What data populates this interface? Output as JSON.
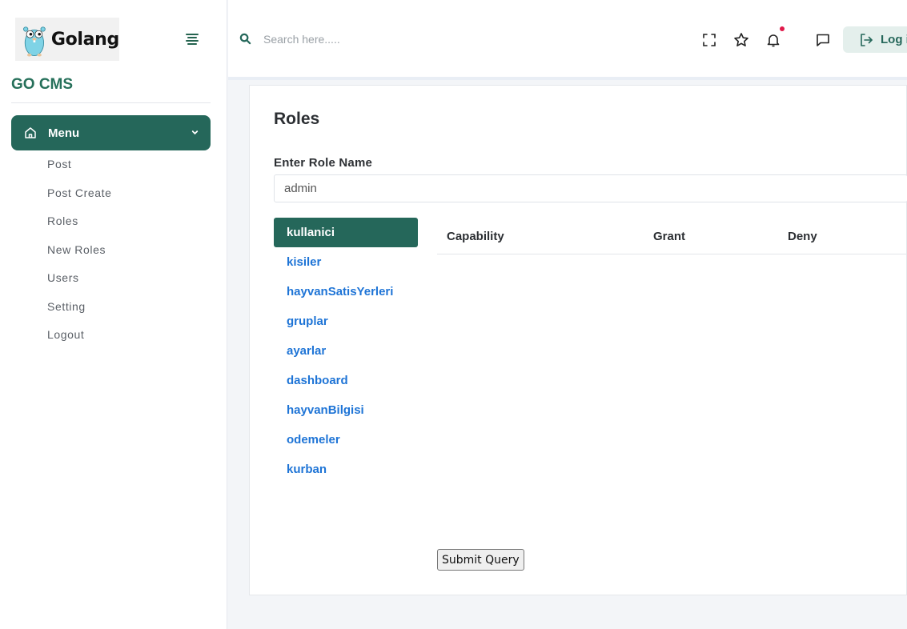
{
  "sidebar": {
    "logo_text": "Golang",
    "brand": "GO CMS",
    "menu_label": "Menu",
    "items": [
      {
        "label": "Post"
      },
      {
        "label": "Post Create"
      },
      {
        "label": "Roles"
      },
      {
        "label": "New Roles"
      },
      {
        "label": "Users"
      },
      {
        "label": "Setting"
      },
      {
        "label": "Logout"
      }
    ]
  },
  "header": {
    "search_placeholder": "Search here.....",
    "login_label": "Log in",
    "icons": [
      "fullscreen-icon",
      "star-icon",
      "bell-icon",
      "chat-icon"
    ]
  },
  "main": {
    "title": "Roles",
    "role_name_label": "Enter Role Name",
    "role_name_value": "admin",
    "tabs": [
      {
        "label": "kullanici",
        "active": true
      },
      {
        "label": "kisiler"
      },
      {
        "label": "hayvanSatisYerleri"
      },
      {
        "label": "gruplar"
      },
      {
        "label": "ayarlar"
      },
      {
        "label": "dashboard"
      },
      {
        "label": "hayvanBilgisi"
      },
      {
        "label": "odemeler"
      },
      {
        "label": "kurban"
      }
    ],
    "table_headers": {
      "capability": "Capability",
      "grant": "Grant",
      "deny": "Deny"
    },
    "submit_label": "Submit Query"
  },
  "colors": {
    "primary": "#25675a",
    "link": "#1e74d6",
    "notification": "#e0194a"
  }
}
